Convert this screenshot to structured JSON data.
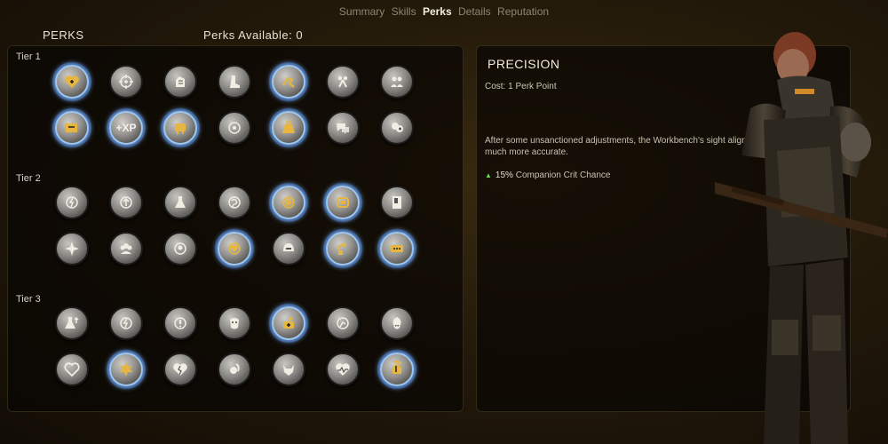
{
  "nav": {
    "tabs": [
      "Summary",
      "Skills",
      "Perks",
      "Details",
      "Reputation"
    ],
    "active": "Perks"
  },
  "header": {
    "title": "PERKS",
    "available_label": "Perks Available: 0"
  },
  "tiers": [
    {
      "label": "Tier 1",
      "rows": [
        [
          {
            "icon": "heart-plus-icon",
            "owned": true
          },
          {
            "icon": "crosshair-plus-icon",
            "owned": false
          },
          {
            "icon": "hand-armor-icon",
            "owned": false
          },
          {
            "icon": "boot-icon",
            "owned": false
          },
          {
            "icon": "running-foot-icon",
            "owned": true
          },
          {
            "icon": "split-figures-icon",
            "owned": false
          },
          {
            "icon": "two-people-icon",
            "owned": false
          }
        ],
        [
          {
            "icon": "ammo-box-icon",
            "owned": true
          },
          {
            "icon": "xp-icon",
            "owned": true,
            "text": "+XP"
          },
          {
            "icon": "carry-hand-icon",
            "owned": true
          },
          {
            "icon": "target-dot-icon",
            "owned": false
          },
          {
            "icon": "weight-icon",
            "owned": true
          },
          {
            "icon": "chat-bubbles-icon",
            "owned": false
          },
          {
            "icon": "heads-plus-icon",
            "owned": false
          }
        ]
      ]
    },
    {
      "label": "Tier 2",
      "rows": [
        [
          {
            "icon": "bolt-crosshair-icon",
            "owned": false
          },
          {
            "icon": "arrow-crosshair-icon",
            "owned": false
          },
          {
            "icon": "flask-icon",
            "owned": false
          },
          {
            "icon": "swirl-crosshair-icon",
            "owned": false
          },
          {
            "icon": "burst-crosshair-icon",
            "owned": true
          },
          {
            "icon": "ammo-clip-icon",
            "owned": true
          },
          {
            "icon": "vending-machine-icon",
            "owned": false
          }
        ],
        [
          {
            "icon": "starburst-icon",
            "owned": false
          },
          {
            "icon": "group-heads-icon",
            "owned": false
          },
          {
            "icon": "head-crosshair-icon",
            "owned": false
          },
          {
            "icon": "heart-crosshair-icon",
            "owned": true
          },
          {
            "icon": "helmet-icon",
            "owned": false
          },
          {
            "icon": "loop-arrows-icon",
            "owned": true
          },
          {
            "icon": "keypad-icon",
            "owned": true
          }
        ]
      ]
    },
    {
      "label": "Tier 3",
      "rows": [
        [
          {
            "icon": "flask-up-icon",
            "owned": false
          },
          {
            "icon": "bolt-crosshair-icon",
            "owned": false
          },
          {
            "icon": "alert-crosshair-icon",
            "owned": false
          },
          {
            "icon": "mask-head-icon",
            "owned": false
          },
          {
            "icon": "plus-figure-icon",
            "owned": true
          },
          {
            "icon": "running-crosshair-icon",
            "owned": false
          },
          {
            "icon": "skull-flame-icon",
            "owned": false
          }
        ],
        [
          {
            "icon": "heart-icon",
            "owned": false
          },
          {
            "icon": "explosion-icon",
            "owned": true
          },
          {
            "icon": "heart-crack-icon",
            "owned": false
          },
          {
            "icon": "feather-head-icon",
            "owned": false
          },
          {
            "icon": "wolf-head-icon",
            "owned": false
          },
          {
            "icon": "heart-pulse-icon",
            "owned": false
          },
          {
            "icon": "spartan-helmet-icon",
            "owned": true
          }
        ]
      ]
    }
  ],
  "detail": {
    "name": "PRECISION",
    "cost": "Cost: 1 Perk Point",
    "description": "After some unsanctioned adjustments, the Workbench's sight alignment tool is much more accurate.",
    "stat_value": "15%",
    "stat_label": "Companion Crit Chance"
  }
}
